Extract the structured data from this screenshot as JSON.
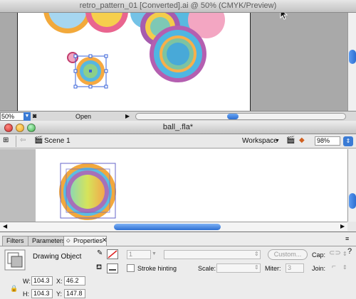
{
  "illustrator": {
    "title": "retro_pattern_01 [Converted].ai @ 50% (CMYK/Preview)",
    "zoom": "50%",
    "status_label": "Open"
  },
  "flash": {
    "title": "ball_.fla*",
    "scene": "Scene 1",
    "workspace": "Workspace",
    "zoom": "98%"
  },
  "panel": {
    "tabs": [
      {
        "label": "Filters"
      },
      {
        "label": "Parameters"
      },
      {
        "label": "Properties"
      }
    ],
    "object_type": "Drawing Object",
    "w_label": "W:",
    "w": "104.3",
    "h_label": "H:",
    "h": "104.3",
    "x_label": "X:",
    "x": "46.2",
    "y_label": "Y:",
    "y": "147.8",
    "stroke_width": "1",
    "custom_label": "Custom...",
    "cap_label": "Cap:",
    "join_label": "Join:",
    "stroke_hinting_label": "Stroke hinting",
    "scale_label": "Scale:",
    "miter_label": "Miter:",
    "miter": "3"
  },
  "colors": {
    "accent": "#3a7bd5",
    "selection": "#6464c8"
  },
  "icons": [
    "apple-icon",
    "close-icon",
    "minimize-icon",
    "zoom-icon",
    "pencil-icon",
    "paint-bucket-icon",
    "lock-icon",
    "scene-icon",
    "back-arrow-icon",
    "edit-symbols-icon"
  ]
}
